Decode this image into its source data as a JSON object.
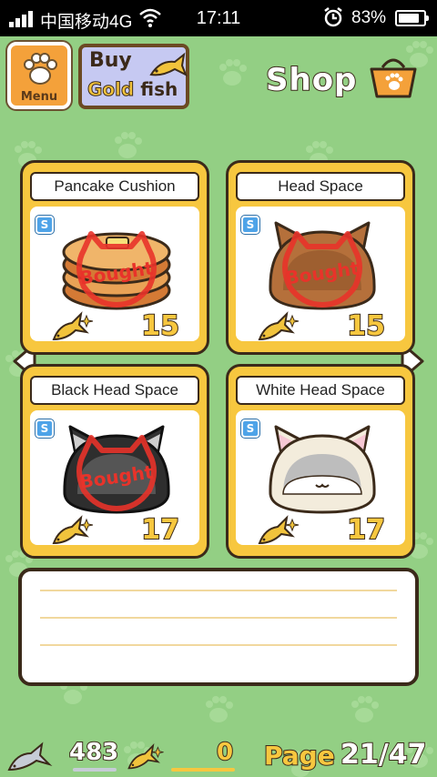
{
  "status_bar": {
    "carrier": "中国移动4G",
    "time": "17:11",
    "battery": "83%",
    "battery_level": 0.83
  },
  "header": {
    "menu_label": "Menu",
    "buy_line1": "Buy",
    "buy_gold": "Gold",
    "buy_fish": "fish",
    "shop_title": "Shop"
  },
  "items": [
    {
      "name": "Pancake Cushion",
      "badge": "S",
      "price": "15",
      "stamp": "Bought"
    },
    {
      "name": "Head Space",
      "badge": "S",
      "price": "15",
      "stamp": "Bought"
    },
    {
      "name": "Black Head Space",
      "badge": "S",
      "price": "17",
      "stamp": "Bought"
    },
    {
      "name": "White Head Space",
      "badge": "S",
      "price": "17"
    }
  ],
  "footer": {
    "silver_fish": "483",
    "gold_fish": "0",
    "page_label": "Page",
    "page_number": "21/47"
  },
  "colors": {
    "background": "#93cf84",
    "card": "#f7c73f",
    "outline": "#3b2a1a",
    "stamp": "#e8332a",
    "buy_button": "#c6c9f2"
  },
  "icons": {
    "menu": "paw-icon",
    "buy": "gold-fish-icon",
    "shop": "basket-icon",
    "currency": "silver-fish-icon"
  }
}
